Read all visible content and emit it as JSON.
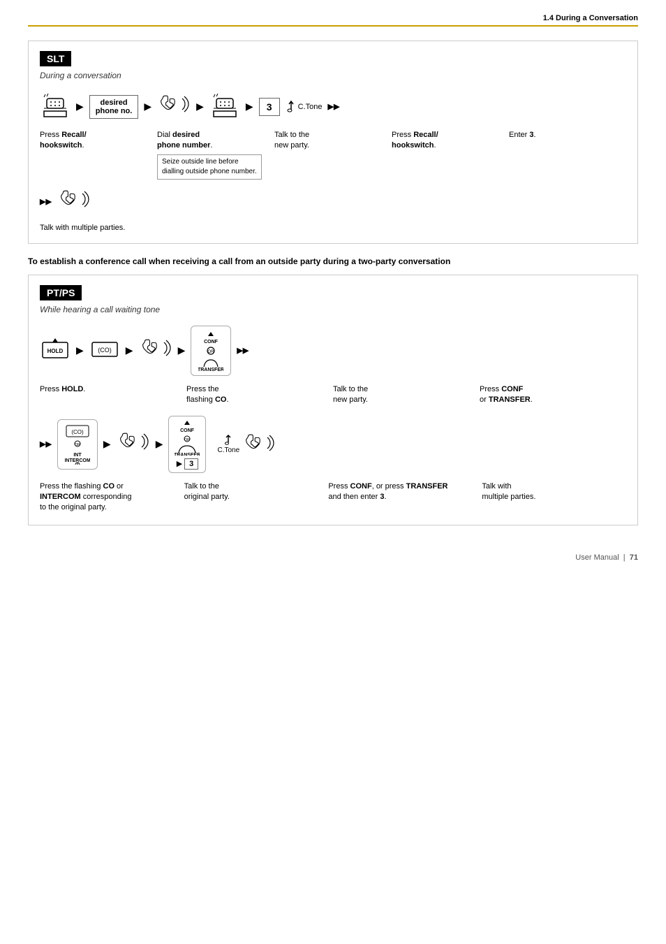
{
  "header": {
    "section": "1.4 During a Conversation"
  },
  "page_number": "71",
  "footer_text": "User Manual",
  "slt_section": {
    "label": "SLT",
    "subtitle": "During a conversation",
    "flow_steps": [
      {
        "icon": "desk-phone",
        "type": "icon"
      },
      {
        "icon": "arrow-right"
      },
      {
        "label": "desired\nphone no.",
        "type": "box"
      },
      {
        "icon": "arrow-right"
      },
      {
        "icon": "handset-waves",
        "type": "icon"
      },
      {
        "icon": "arrow-right"
      },
      {
        "icon": "desk-phone",
        "type": "icon"
      },
      {
        "icon": "arrow-right"
      },
      {
        "label": "3",
        "type": "box-num"
      },
      {
        "label": "C.Tone",
        "type": "ctone"
      },
      {
        "icon": "dbl-arrow"
      }
    ],
    "descriptions": [
      {
        "id": "desc1",
        "text_html": "Press <b>Recall/\nhookswitch</b>."
      },
      {
        "id": "desc2",
        "text_html": "Dial <b>desired\nphone number</b>.",
        "note": "Seize outside line before\ndialling outside phone number."
      },
      {
        "id": "desc3",
        "text_html": "Talk to the\nnew party."
      },
      {
        "id": "desc4",
        "text_html": "Press <b>Recall/\nhookswitch</b>."
      },
      {
        "id": "desc5",
        "text_html": "Enter <b>3</b>."
      }
    ],
    "flow2_steps": [
      {
        "icon": "dbl-arrow"
      },
      {
        "icon": "handset-waves",
        "type": "icon"
      }
    ],
    "desc_bottom": "Talk with multiple parties."
  },
  "conference_heading": "To establish a conference call when receiving a call from an outside party during a two-party conversation",
  "ptps_section": {
    "label": "PT/PS",
    "subtitle": "While hearing a call waiting tone",
    "flow1_steps": [
      {
        "icon": "hold-btn",
        "type": "btn"
      },
      {
        "icon": "arrow-right"
      },
      {
        "icon": "co-btn",
        "type": "btn"
      },
      {
        "icon": "arrow-right"
      },
      {
        "icon": "handset-waves",
        "type": "icon"
      },
      {
        "icon": "arrow-right"
      },
      {
        "icon": "conf-transfer-group",
        "type": "group"
      },
      {
        "icon": "dbl-arrow"
      }
    ],
    "desc1": [
      {
        "text_html": "Press <b>HOLD</b>."
      },
      {
        "text_html": "Press the\nflashing <b>CO</b>."
      },
      {
        "text_html": "Talk to the\nnew party."
      },
      {
        "text_html": "Press <b>CONF</b>\nor <b>TRANSFER</b>."
      }
    ],
    "flow2_steps": [
      {
        "icon": "dbl-arrow"
      },
      {
        "icon": "co-intercom-group",
        "type": "group"
      },
      {
        "icon": "arrow-right"
      },
      {
        "icon": "handset-waves",
        "type": "icon"
      },
      {
        "icon": "arrow-right"
      },
      {
        "icon": "conf-transfer-3-group",
        "type": "group"
      },
      {
        "icon": "ctone-handset",
        "type": "ctone-handset"
      }
    ],
    "desc2": [
      {
        "text_html": "Press the flashing <b>CO</b> or\n<b>INTERCOM</b> corresponding\nto the original party."
      },
      {
        "text_html": "Talk to the\noriginal party."
      },
      {
        "text_html": "Press <b>CONF</b>, or press <b>TRANSFER</b>\nand then enter <b>3</b>."
      },
      {
        "text_html": "Talk with\nmultiple parties."
      }
    ]
  }
}
